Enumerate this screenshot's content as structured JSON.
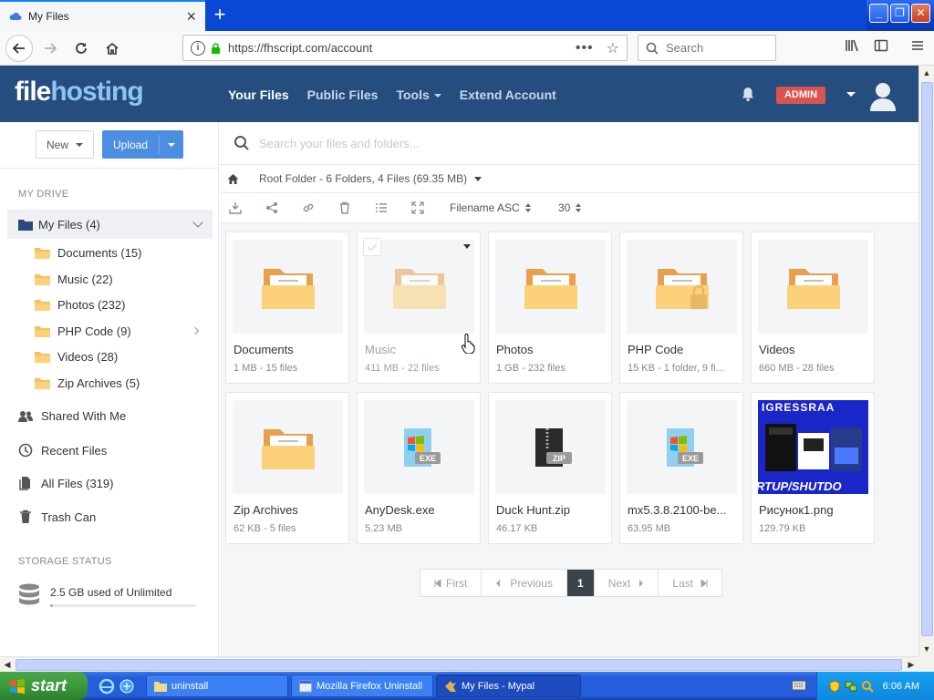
{
  "browser": {
    "tab_title": "My Files",
    "tab_close": "×",
    "new_tab": "+",
    "url": "https://fhscript.com/account",
    "page_actions": "•••",
    "search_placeholder": "Search",
    "window_controls": {
      "minimize": "_",
      "restore": "❐",
      "close": "✕"
    }
  },
  "site": {
    "logo_part1": "file",
    "logo_part2": "hosting",
    "nav": [
      {
        "label": "Your Files",
        "active": true
      },
      {
        "label": "Public Files",
        "active": false
      },
      {
        "label": "Tools",
        "active": false,
        "dropdown": true
      },
      {
        "label": "Extend Account",
        "active": false
      }
    ],
    "admin_badge": "ADMIN"
  },
  "sidebar": {
    "new_label": "New",
    "upload_label": "Upload",
    "my_drive_label": "MY DRIVE",
    "my_files_label": "My Files (4)",
    "folders": [
      {
        "label": "Documents (15)",
        "expandable": false
      },
      {
        "label": "Music (22)",
        "expandable": false
      },
      {
        "label": "Photos (232)",
        "expandable": false
      },
      {
        "label": "PHP Code (9)",
        "expandable": true
      },
      {
        "label": "Videos (28)",
        "expandable": false
      },
      {
        "label": "Zip Archives (5)",
        "expandable": false
      }
    ],
    "links": [
      {
        "label": "Shared With Me",
        "icon": "users-icon"
      },
      {
        "label": "Recent Files",
        "icon": "clock-icon"
      },
      {
        "label": "All Files (319)",
        "icon": "files-icon"
      },
      {
        "label": "Trash Can",
        "icon": "trash-icon"
      }
    ],
    "storage_label": "STORAGE STATUS",
    "storage_text": "2.5 GB used of Unlimited",
    "storage_fraction": 0.02
  },
  "main": {
    "search_placeholder": "Search your files and folders...",
    "breadcrumb": "Root Folder - 6 Folders, 4 Files (69.35 MB)",
    "sort_label": "Filename ASC",
    "per_page": "30",
    "items": [
      {
        "name": "Documents",
        "meta": "1 MB - 15 files",
        "kind": "folder"
      },
      {
        "name": "Music",
        "meta": "411 MB - 22 files",
        "kind": "folder",
        "hover": true
      },
      {
        "name": "Photos",
        "meta": "1 GB - 232 files",
        "kind": "folder"
      },
      {
        "name": "PHP Code",
        "meta": "15 KB - 1 folder, 9 fi...",
        "kind": "folder-locked"
      },
      {
        "name": "Videos",
        "meta": "660 MB - 28 files",
        "kind": "folder"
      },
      {
        "name": "Zip Archives",
        "meta": "62 KB - 5 files",
        "kind": "folder"
      },
      {
        "name": "AnyDesk.exe",
        "meta": "5.23 MB",
        "kind": "exe",
        "badge": "EXE"
      },
      {
        "name": "Duck Hunt.zip",
        "meta": "46.17 KB",
        "kind": "zip",
        "badge": "ZIP"
      },
      {
        "name": "mx5.3.8.2100-be...",
        "meta": "63.95 MB",
        "kind": "exe",
        "badge": "EXE"
      },
      {
        "name": "Рисунок1.png",
        "meta": "129.79 KB",
        "kind": "image",
        "image_text": "IGRESSRAA",
        "image_text2": "RTUP/SHUTDO"
      }
    ],
    "pager": {
      "first": "First",
      "previous": "Previous",
      "current": "1",
      "next": "Next",
      "last": "Last"
    }
  },
  "taskbar": {
    "start": "start",
    "tasks": [
      {
        "label": "uninstall",
        "active": false
      },
      {
        "label": "Mozilla Firefox Uninstall",
        "active": false
      },
      {
        "label": "My Files - Mypal",
        "active": true
      }
    ],
    "clock": "6:06 AM"
  },
  "colors": {
    "header": "#254d7e",
    "upload": "#4c8ee0",
    "admin": "#d9534f",
    "folder_front": "#fbd27a",
    "folder_back": "#e8a04f"
  }
}
